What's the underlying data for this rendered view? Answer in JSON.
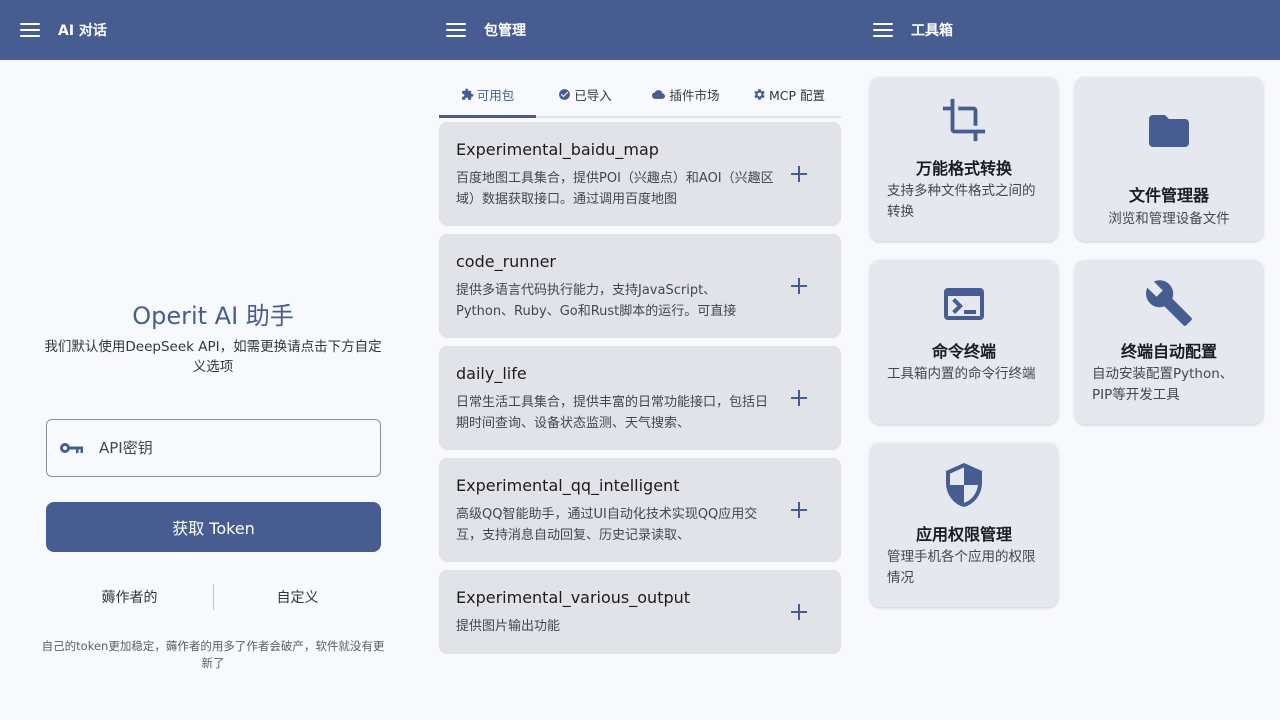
{
  "topbar": {
    "sections": [
      {
        "title": "AI 对话"
      },
      {
        "title": "包管理"
      },
      {
        "title": "工具箱"
      }
    ]
  },
  "ai_panel": {
    "title": "Operit AI 助手",
    "subtitle": "我们默认使用DeepSeek API，如需更换请点击下方自定义选项",
    "api_key_placeholder": "API密钥",
    "token_button": "获取 Token",
    "option_left": "薅作者的",
    "option_right": "自定义",
    "note": "自己的token更加稳定，薅作者的用多了作者会破产，软件就没有更新了"
  },
  "package_panel": {
    "tabs": [
      {
        "label": "可用包",
        "icon": "puzzle-icon",
        "active": true
      },
      {
        "label": "已导入",
        "icon": "check-circle-icon",
        "active": false
      },
      {
        "label": "插件市场",
        "icon": "cloud-icon",
        "active": false
      },
      {
        "label": "MCP 配置",
        "icon": "gear-icon",
        "active": false
      }
    ],
    "packages": [
      {
        "name": "Experimental_baidu_map",
        "desc": "百度地图工具集合，提供POI（兴趣点）和AOI（兴趣区域）数据获取接口。通过调用百度地图"
      },
      {
        "name": "code_runner",
        "desc": "提供多语言代码执行能力，支持JavaScript、Python、Ruby、Go和Rust脚本的运行。可直接"
      },
      {
        "name": "daily_life",
        "desc": "日常生活工具集合，提供丰富的日常功能接口，包括日期时间查询、设备状态监测、天气搜索、"
      },
      {
        "name": "Experimental_qq_intelligent",
        "desc": "高级QQ智能助手，通过UI自动化技术实现QQ应用交互，支持消息自动回复、历史记录读取、"
      },
      {
        "name": "Experimental_various_output",
        "desc": "提供图片输出功能"
      }
    ]
  },
  "toolbox_panel": {
    "accent": "#475d92",
    "tools": [
      {
        "title": "万能格式转换",
        "desc": "支持多种文件格式之间的转换",
        "icon": "crop-icon"
      },
      {
        "title": "文件管理器",
        "desc": "浏览和管理设备文件",
        "icon": "folder-icon"
      },
      {
        "title": "命令终端",
        "desc": "工具箱内置的命令行终端",
        "icon": "terminal-icon"
      },
      {
        "title": "终端自动配置",
        "desc": "自动安装配置Python、PIP等开发工具",
        "icon": "wrench-icon"
      },
      {
        "title": "应用权限管理",
        "desc": "管理手机各个应用的权限情况",
        "icon": "shield-icon"
      }
    ]
  }
}
